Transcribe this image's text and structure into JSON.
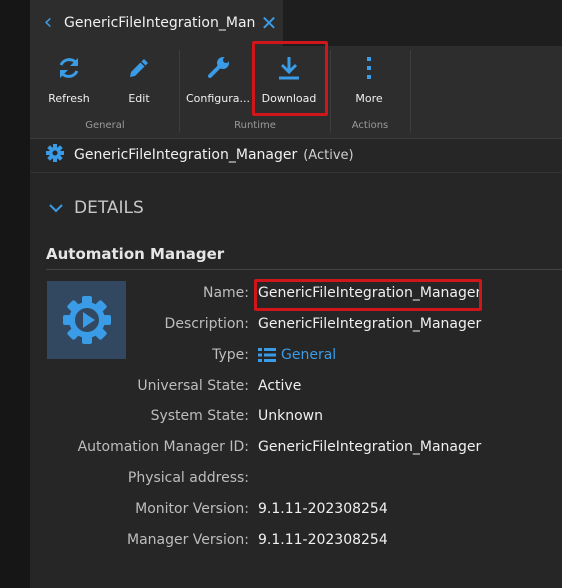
{
  "tab": {
    "title": "GenericFileIntegration_Manager"
  },
  "ribbon": {
    "buttons": {
      "refresh": "Refresh",
      "edit": "Edit",
      "configure": "Configura...",
      "download": "Download",
      "more": "More"
    },
    "groups": {
      "general": "General",
      "runtime": "Runtime",
      "actions": "Actions"
    }
  },
  "entity": {
    "name": "GenericFileIntegration_Manager",
    "state": "(Active)"
  },
  "details": {
    "header": "DETAILS",
    "section_title": "Automation Manager",
    "fields": [
      {
        "label": "Name:",
        "value": "GenericFileIntegration_Manager"
      },
      {
        "label": "Description:",
        "value": "GenericFileIntegration_Manager"
      },
      {
        "label": "Type:",
        "value": "General"
      },
      {
        "label": "Universal State:",
        "value": "Active"
      },
      {
        "label": "System State:",
        "value": "Unknown"
      },
      {
        "label": "Automation Manager ID:",
        "value": "GenericFileIntegration_Manager"
      },
      {
        "label": "Physical address:",
        "value": ""
      },
      {
        "label": "Monitor Version:",
        "value": "9.1.11-202308254"
      },
      {
        "label": "Manager Version:",
        "value": "9.1.11-202308254"
      }
    ]
  },
  "colors": {
    "accent": "#3a9be6",
    "highlight": "#d0161b",
    "background": "#262626"
  }
}
